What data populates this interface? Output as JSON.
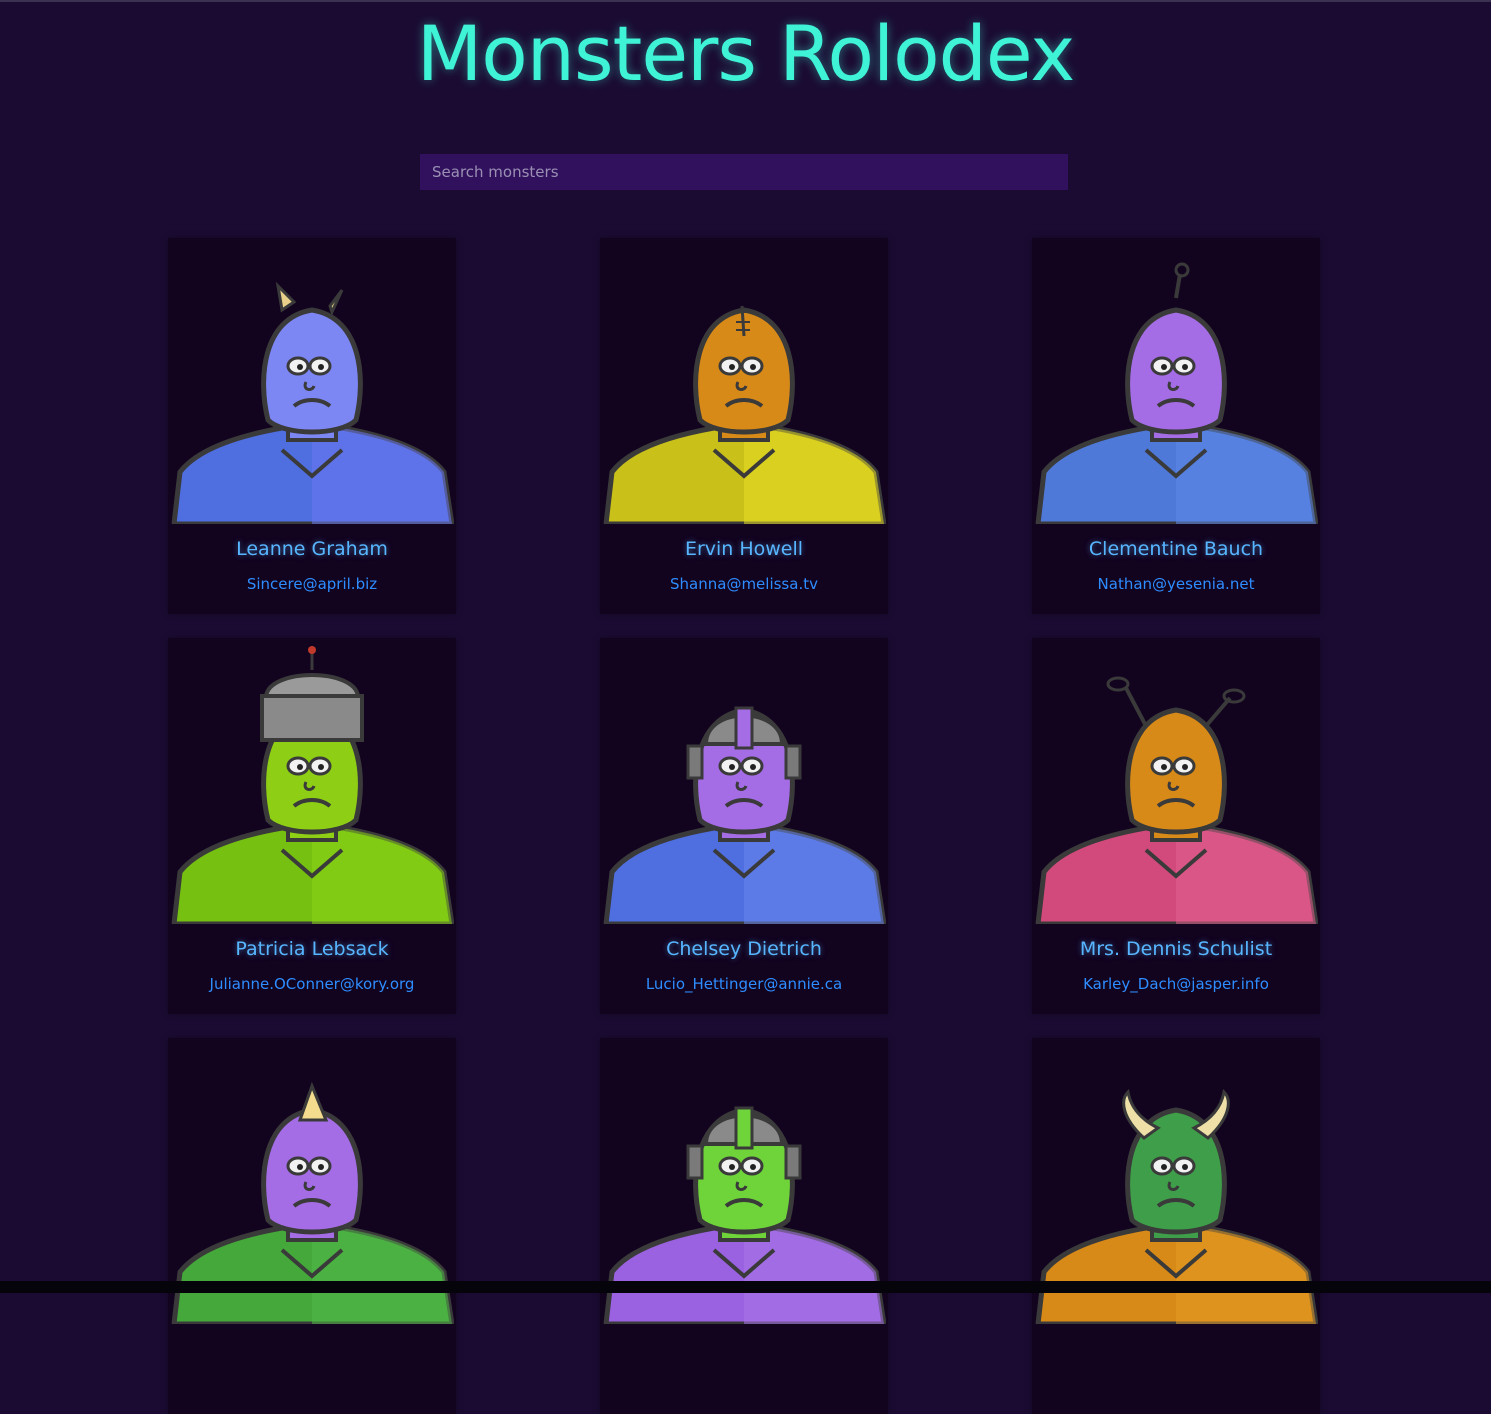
{
  "app": {
    "title": "Monsters Rolodex"
  },
  "search": {
    "placeholder": "Search monsters",
    "value": ""
  },
  "colors": {
    "background": "#1b0b33",
    "title": "#3ff3d6",
    "card_background": "#12031f",
    "search_background": "#31115d",
    "name_text": "#57b6ff",
    "email_text": "#2e8dff"
  },
  "monsters": [
    {
      "name": "Leanne Graham",
      "email": "Sincere@april.biz",
      "skin": "#7d87f3",
      "body": "#4f6ee0",
      "accent": "#6c79f0",
      "feature": "horns-small"
    },
    {
      "name": "Ervin Howell",
      "email": "Shanna@melissa.tv",
      "skin": "#d88a18",
      "body": "#c9c11a",
      "accent": "#e5dc25",
      "feature": "stitch"
    },
    {
      "name": "Clementine Bauch",
      "email": "Nathan@yesenia.net",
      "skin": "#a56de5",
      "body": "#4f79d9",
      "accent": "#5d88e8",
      "feature": "antenna"
    },
    {
      "name": "Patricia Lebsack",
      "email": "Julianne.OConner@kory.org",
      "skin": "#8ecf16",
      "body": "#76c012",
      "accent": "#8ad417",
      "feature": "helmet-tall"
    },
    {
      "name": "Chelsey Dietrich",
      "email": "Lucio_Hettinger@annie.ca",
      "skin": "#a56de5",
      "body": "#4f6ee0",
      "accent": "#6a86ec",
      "feature": "helmet-robot"
    },
    {
      "name": "Mrs. Dennis Schulist",
      "email": "Karley_Dach@jasper.info",
      "skin": "#d88a18",
      "body": "#d24a7c",
      "accent": "#e0608e",
      "feature": "antennae"
    },
    {
      "name": "",
      "email": "",
      "skin": "#a56de5",
      "body": "#44a83a",
      "accent": "#52b848",
      "feature": "horn-single"
    },
    {
      "name": "",
      "email": "",
      "skin": "#6fd43a",
      "body": "#9a62e0",
      "accent": "#a974ea",
      "feature": "helmet-robot"
    },
    {
      "name": "",
      "email": "",
      "skin": "#3f9e4a",
      "body": "#d88a18",
      "accent": "#e49a25",
      "feature": "horns-big"
    }
  ]
}
